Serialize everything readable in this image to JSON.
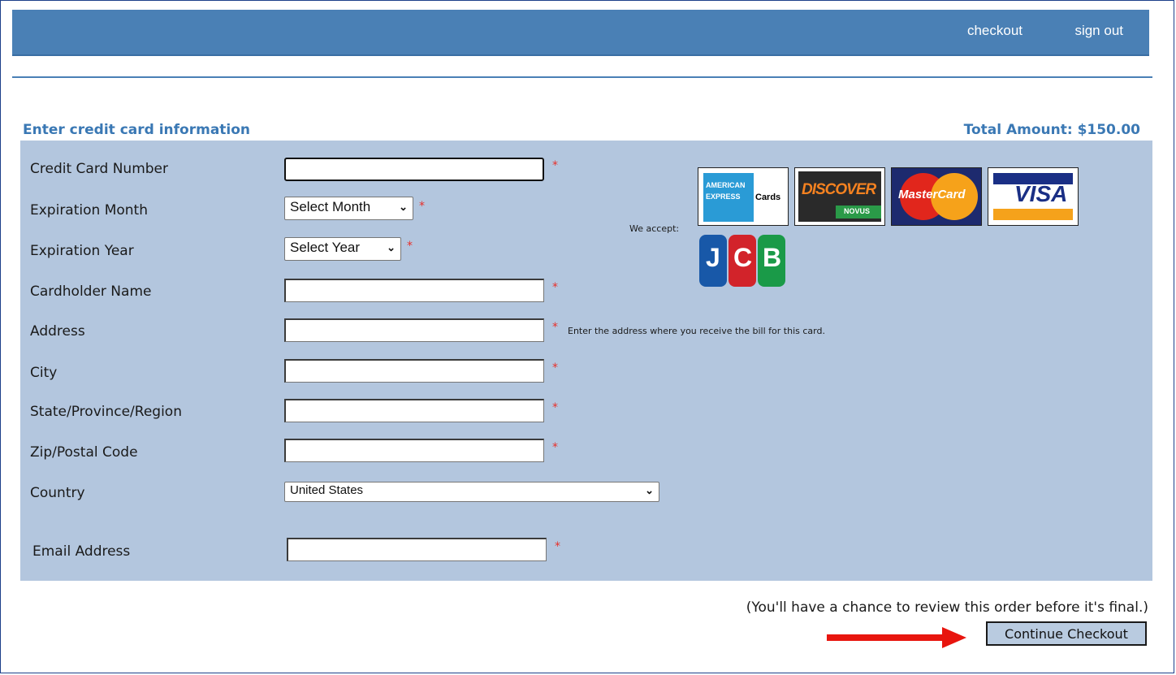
{
  "nav": {
    "checkout": "checkout",
    "sign_out": "sign out"
  },
  "header": {
    "section_title": "Enter credit card information",
    "total": "Total Amount: $150.00"
  },
  "form": {
    "card_number": {
      "label": "Credit Card Number",
      "value": ""
    },
    "exp_month": {
      "label": "Expiration Month",
      "selected": "Select Month"
    },
    "exp_year": {
      "label": "Expiration Year",
      "selected": "Select Year"
    },
    "cardholder": {
      "label": "Cardholder Name",
      "value": ""
    },
    "address": {
      "label": "Address",
      "value": "",
      "hint": "Enter the address where you receive the bill for this card."
    },
    "city": {
      "label": "City",
      "value": ""
    },
    "state": {
      "label": "State/Province/Region",
      "value": ""
    },
    "zip": {
      "label": "Zip/Postal Code",
      "value": ""
    },
    "country": {
      "label": "Country",
      "selected": "United States"
    },
    "email": {
      "label": "Email Address",
      "value": ""
    },
    "required_mark": "*"
  },
  "cards": {
    "label": "We accept:",
    "amex": {
      "line1": "AMERICAN",
      "line2": "EXPRESS",
      "line3": "Cards"
    },
    "discover": {
      "name": "DISCOVER",
      "sub": "NOVUS"
    },
    "mastercard": {
      "name": "MasterCard"
    },
    "visa": {
      "name": "VISA"
    },
    "jcb": {
      "j": "J",
      "c": "C",
      "b": "B"
    }
  },
  "footer": {
    "review_note": "(You'll have a chance to review this order before it's final.)",
    "continue_label": "Continue Checkout"
  },
  "colors": {
    "accent": "#4a80b5",
    "panel": "#b3c6de",
    "required": "#e8302a",
    "arrow": "#e8150e"
  }
}
